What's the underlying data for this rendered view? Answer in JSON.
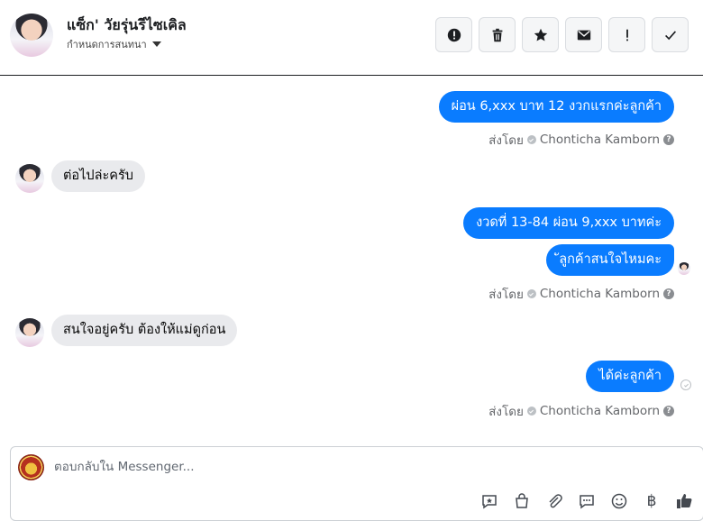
{
  "header": {
    "contact_name": "แซ็ก' วัยรุ่นรีไซเคิล",
    "subtitle": "กำหนดการสนทนา",
    "actions": [
      {
        "name": "report-icon",
        "label": "!"
      },
      {
        "name": "trash-icon",
        "label": ""
      },
      {
        "name": "star-icon",
        "label": ""
      },
      {
        "name": "mail-icon",
        "label": ""
      },
      {
        "name": "exclamation-icon",
        "label": "!"
      },
      {
        "name": "check-icon",
        "label": ""
      }
    ]
  },
  "messages": [
    {
      "dir": "out",
      "text": "ผ่อน 6,xxx บาท 12 งวกแรกค่ะลูกค้า"
    },
    {
      "dir": "meta",
      "prefix": "ส่งโดย",
      "agent": "Chonticha Kamborn"
    },
    {
      "dir": "in",
      "text": "ต่อไปล่ะครับ"
    },
    {
      "dir": "out",
      "text": "งวดที่ 13-84 ผ่อน 9,xxx บาทค่ะ"
    },
    {
      "dir": "out",
      "text": "ัลูกค้าสนใจไหมคะ"
    },
    {
      "dir": "meta",
      "prefix": "ส่งโดย",
      "agent": "Chonticha Kamborn"
    },
    {
      "dir": "in",
      "text": "สนใจอยู่ครับ ต้องให้แม่ดูก่อน"
    },
    {
      "dir": "out",
      "text": "ได้ค่ะลูกค้า"
    },
    {
      "dir": "meta",
      "prefix": "ส่งโดย",
      "agent": "Chonticha Kamborn"
    }
  ],
  "composer": {
    "placeholder": "ตอบกลับใน Messenger...",
    "tools": [
      "saved-reply-icon",
      "shopping-bag-icon",
      "attachment-icon",
      "chat-icon",
      "emoji-icon",
      "baht-icon",
      "like-icon"
    ],
    "baht_symbol": "฿"
  },
  "colors": {
    "outgoing_bubble": "#0a7cff",
    "incoming_bubble": "#e9eaed",
    "meta_text": "#65676b"
  }
}
